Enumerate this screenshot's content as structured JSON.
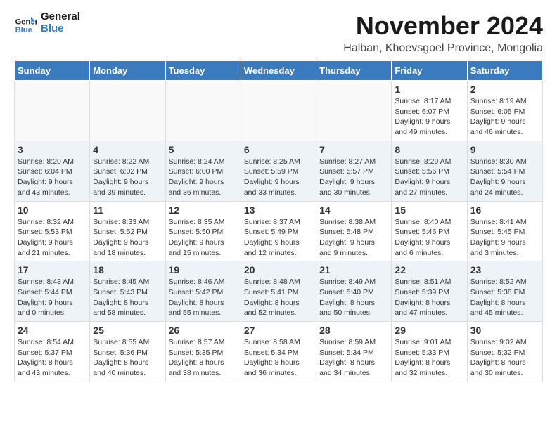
{
  "header": {
    "logo_line1": "General",
    "logo_line2": "Blue",
    "month_title": "November 2024",
    "location": "Halban, Khoevsgoel Province, Mongolia"
  },
  "weekdays": [
    "Sunday",
    "Monday",
    "Tuesday",
    "Wednesday",
    "Thursday",
    "Friday",
    "Saturday"
  ],
  "weeks": [
    [
      {
        "day": "",
        "info": ""
      },
      {
        "day": "",
        "info": ""
      },
      {
        "day": "",
        "info": ""
      },
      {
        "day": "",
        "info": ""
      },
      {
        "day": "",
        "info": ""
      },
      {
        "day": "1",
        "info": "Sunrise: 8:17 AM\nSunset: 6:07 PM\nDaylight: 9 hours and 49 minutes."
      },
      {
        "day": "2",
        "info": "Sunrise: 8:19 AM\nSunset: 6:05 PM\nDaylight: 9 hours and 46 minutes."
      }
    ],
    [
      {
        "day": "3",
        "info": "Sunrise: 8:20 AM\nSunset: 6:04 PM\nDaylight: 9 hours and 43 minutes."
      },
      {
        "day": "4",
        "info": "Sunrise: 8:22 AM\nSunset: 6:02 PM\nDaylight: 9 hours and 39 minutes."
      },
      {
        "day": "5",
        "info": "Sunrise: 8:24 AM\nSunset: 6:00 PM\nDaylight: 9 hours and 36 minutes."
      },
      {
        "day": "6",
        "info": "Sunrise: 8:25 AM\nSunset: 5:59 PM\nDaylight: 9 hours and 33 minutes."
      },
      {
        "day": "7",
        "info": "Sunrise: 8:27 AM\nSunset: 5:57 PM\nDaylight: 9 hours and 30 minutes."
      },
      {
        "day": "8",
        "info": "Sunrise: 8:29 AM\nSunset: 5:56 PM\nDaylight: 9 hours and 27 minutes."
      },
      {
        "day": "9",
        "info": "Sunrise: 8:30 AM\nSunset: 5:54 PM\nDaylight: 9 hours and 24 minutes."
      }
    ],
    [
      {
        "day": "10",
        "info": "Sunrise: 8:32 AM\nSunset: 5:53 PM\nDaylight: 9 hours and 21 minutes."
      },
      {
        "day": "11",
        "info": "Sunrise: 8:33 AM\nSunset: 5:52 PM\nDaylight: 9 hours and 18 minutes."
      },
      {
        "day": "12",
        "info": "Sunrise: 8:35 AM\nSunset: 5:50 PM\nDaylight: 9 hours and 15 minutes."
      },
      {
        "day": "13",
        "info": "Sunrise: 8:37 AM\nSunset: 5:49 PM\nDaylight: 9 hours and 12 minutes."
      },
      {
        "day": "14",
        "info": "Sunrise: 8:38 AM\nSunset: 5:48 PM\nDaylight: 9 hours and 9 minutes."
      },
      {
        "day": "15",
        "info": "Sunrise: 8:40 AM\nSunset: 5:46 PM\nDaylight: 9 hours and 6 minutes."
      },
      {
        "day": "16",
        "info": "Sunrise: 8:41 AM\nSunset: 5:45 PM\nDaylight: 9 hours and 3 minutes."
      }
    ],
    [
      {
        "day": "17",
        "info": "Sunrise: 8:43 AM\nSunset: 5:44 PM\nDaylight: 9 hours and 0 minutes."
      },
      {
        "day": "18",
        "info": "Sunrise: 8:45 AM\nSunset: 5:43 PM\nDaylight: 8 hours and 58 minutes."
      },
      {
        "day": "19",
        "info": "Sunrise: 8:46 AM\nSunset: 5:42 PM\nDaylight: 8 hours and 55 minutes."
      },
      {
        "day": "20",
        "info": "Sunrise: 8:48 AM\nSunset: 5:41 PM\nDaylight: 8 hours and 52 minutes."
      },
      {
        "day": "21",
        "info": "Sunrise: 8:49 AM\nSunset: 5:40 PM\nDaylight: 8 hours and 50 minutes."
      },
      {
        "day": "22",
        "info": "Sunrise: 8:51 AM\nSunset: 5:39 PM\nDaylight: 8 hours and 47 minutes."
      },
      {
        "day": "23",
        "info": "Sunrise: 8:52 AM\nSunset: 5:38 PM\nDaylight: 8 hours and 45 minutes."
      }
    ],
    [
      {
        "day": "24",
        "info": "Sunrise: 8:54 AM\nSunset: 5:37 PM\nDaylight: 8 hours and 43 minutes."
      },
      {
        "day": "25",
        "info": "Sunrise: 8:55 AM\nSunset: 5:36 PM\nDaylight: 8 hours and 40 minutes."
      },
      {
        "day": "26",
        "info": "Sunrise: 8:57 AM\nSunset: 5:35 PM\nDaylight: 8 hours and 38 minutes."
      },
      {
        "day": "27",
        "info": "Sunrise: 8:58 AM\nSunset: 5:34 PM\nDaylight: 8 hours and 36 minutes."
      },
      {
        "day": "28",
        "info": "Sunrise: 8:59 AM\nSunset: 5:34 PM\nDaylight: 8 hours and 34 minutes."
      },
      {
        "day": "29",
        "info": "Sunrise: 9:01 AM\nSunset: 5:33 PM\nDaylight: 8 hours and 32 minutes."
      },
      {
        "day": "30",
        "info": "Sunrise: 9:02 AM\nSunset: 5:32 PM\nDaylight: 8 hours and 30 minutes."
      }
    ]
  ]
}
